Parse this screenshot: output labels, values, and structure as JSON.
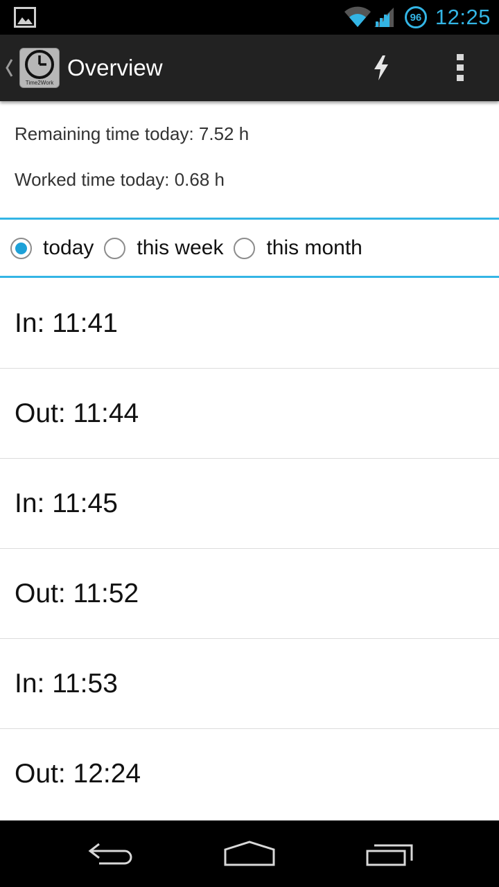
{
  "status_bar": {
    "time": "12:25",
    "battery_level": "96",
    "icons": [
      "picture-notification-icon",
      "wifi-icon",
      "cell-signal-icon",
      "battery-icon"
    ],
    "accent_color": "#33b5e5"
  },
  "action_bar": {
    "title": "Overview",
    "app_icon_label": "Time2Work",
    "icons": [
      "up-caret-icon",
      "flash-icon",
      "overflow-menu-icon"
    ]
  },
  "summary": {
    "remaining": "Remaining time today: 7.52 h",
    "worked": "Worked time today: 0.68 h"
  },
  "period_filter": {
    "options": [
      {
        "label": "today",
        "selected": true
      },
      {
        "label": "this week",
        "selected": false
      },
      {
        "label": "this month",
        "selected": false
      }
    ]
  },
  "entries": [
    {
      "text": "In: 11:41"
    },
    {
      "text": "Out: 11:44"
    },
    {
      "text": "In: 11:45"
    },
    {
      "text": "Out: 11:52"
    },
    {
      "text": "In: 11:53"
    },
    {
      "text": "Out: 12:24"
    }
  ],
  "nav_bar": {
    "icons": [
      "back-icon",
      "home-icon",
      "recents-icon"
    ]
  }
}
